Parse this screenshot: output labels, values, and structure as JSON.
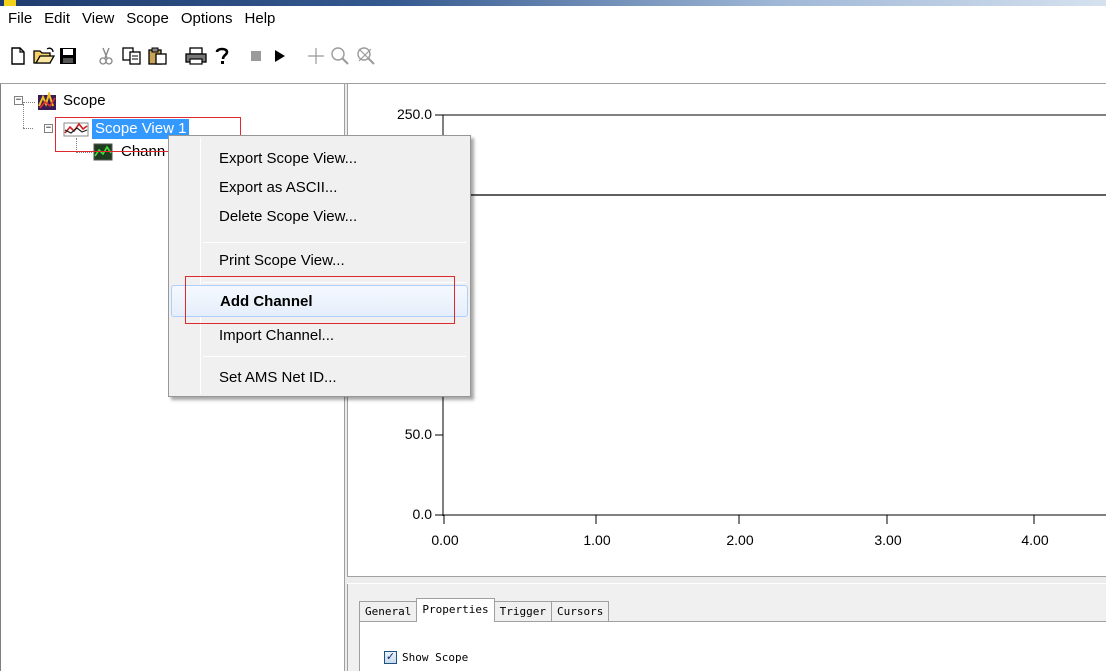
{
  "menubar": {
    "items": [
      "File",
      "Edit",
      "View",
      "Scope",
      "Options",
      "Help"
    ]
  },
  "toolbar": {
    "buttons": [
      "new-icon",
      "open-icon",
      "save-icon",
      "cut-icon",
      "copy-icon",
      "paste-icon",
      "print-icon",
      "help-icon",
      "stop-icon",
      "run-icon",
      "crosshair-icon",
      "zoom-icon",
      "zoom-reset-icon"
    ]
  },
  "tree": {
    "root_label": "Scope",
    "view_label": "Scope View 1",
    "channel_label": "Chann"
  },
  "context_menu": {
    "items": [
      "Export Scope  View...",
      "Export as ASCII...",
      "Delete Scope View...",
      "Print Scope View...",
      "Add Channel",
      "Import Channel...",
      "Set AMS Net ID..."
    ]
  },
  "chart": {
    "y_ticks": [
      "250.0",
      "50.0",
      "0.0"
    ],
    "x_ticks": [
      "0.00",
      "1.00",
      "2.00",
      "3.00",
      "4.00"
    ]
  },
  "props_panel": {
    "tabs": [
      "General",
      "Properties",
      "Trigger",
      "Cursors"
    ],
    "show_scope_label": "Show Scope",
    "show_scope_checked": true
  },
  "colors": {
    "selection": "#3399ff",
    "highlight_box": "#e0282e",
    "menu_hover_border": "#aecff7"
  }
}
